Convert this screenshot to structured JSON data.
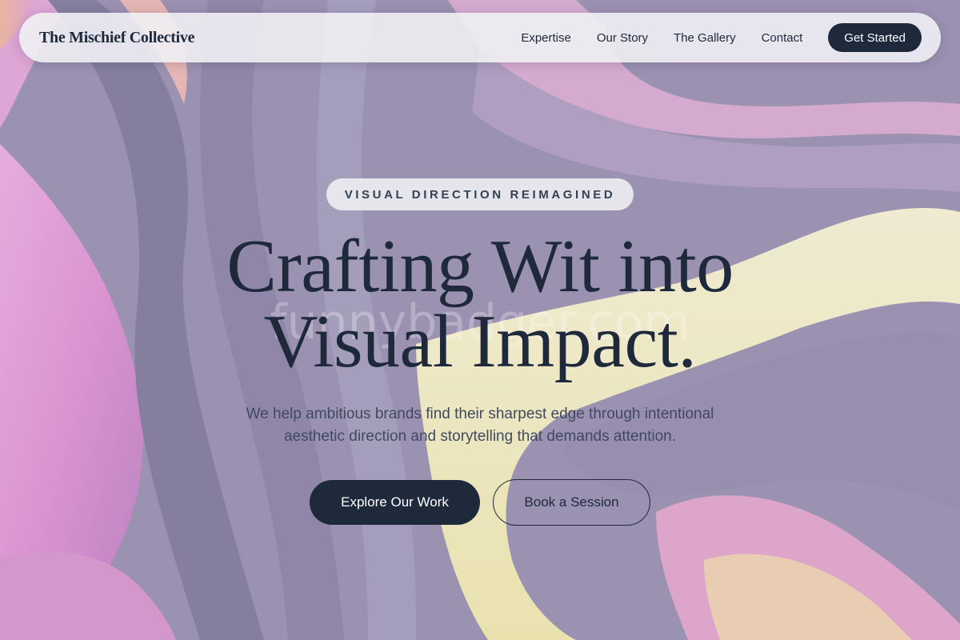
{
  "nav": {
    "brand": "The Mischief Collective",
    "links": [
      "Expertise",
      "Our Story",
      "The Gallery",
      "Contact"
    ],
    "cta": "Get Started"
  },
  "hero": {
    "eyebrow": "VISUAL DIRECTION REIMAGINED",
    "headline_line1": "Crafting Wit into",
    "headline_line2": "Visual Impact.",
    "subtitle_line1": "We help ambitious brands find their sharpest edge through intentional",
    "subtitle_line2": "aesthetic direction and storytelling that demands attention.",
    "primary_button": "Explore Our Work",
    "secondary_button": "Book a Session"
  },
  "watermark": "funnybadger.com",
  "colors": {
    "ink": "#1e293b",
    "nav_bg": "#f0f0f4",
    "bg_purple": "#8a7fa3",
    "bg_pink": "#e88bd0",
    "bg_yellow": "#fbf6b4"
  }
}
